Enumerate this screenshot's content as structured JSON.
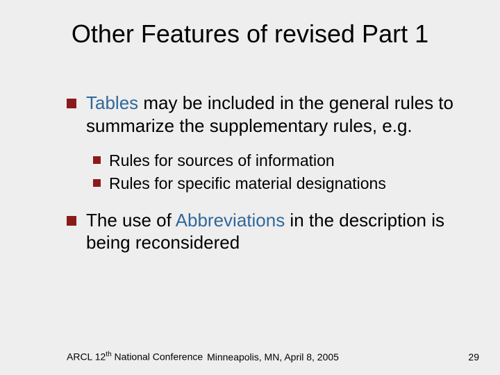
{
  "title": "Other Features of revised Part 1",
  "bullets": [
    {
      "prefix": "",
      "keyword": "Tables",
      "suffix": " may be included in the general rules to summarize the supplementary rules, e.g.",
      "sub": [
        "Rules for sources of information",
        "Rules for specific material designations"
      ]
    },
    {
      "prefix": "The use of ",
      "keyword": "Abbreviations",
      "suffix": " in the description is being reconsidered",
      "sub": []
    }
  ],
  "footer": {
    "left_a": "ARCL 12",
    "left_sup": "th",
    "left_b": " National Conference",
    "center": "Minneapolis, MN, April 8, 2005",
    "right": "29"
  }
}
